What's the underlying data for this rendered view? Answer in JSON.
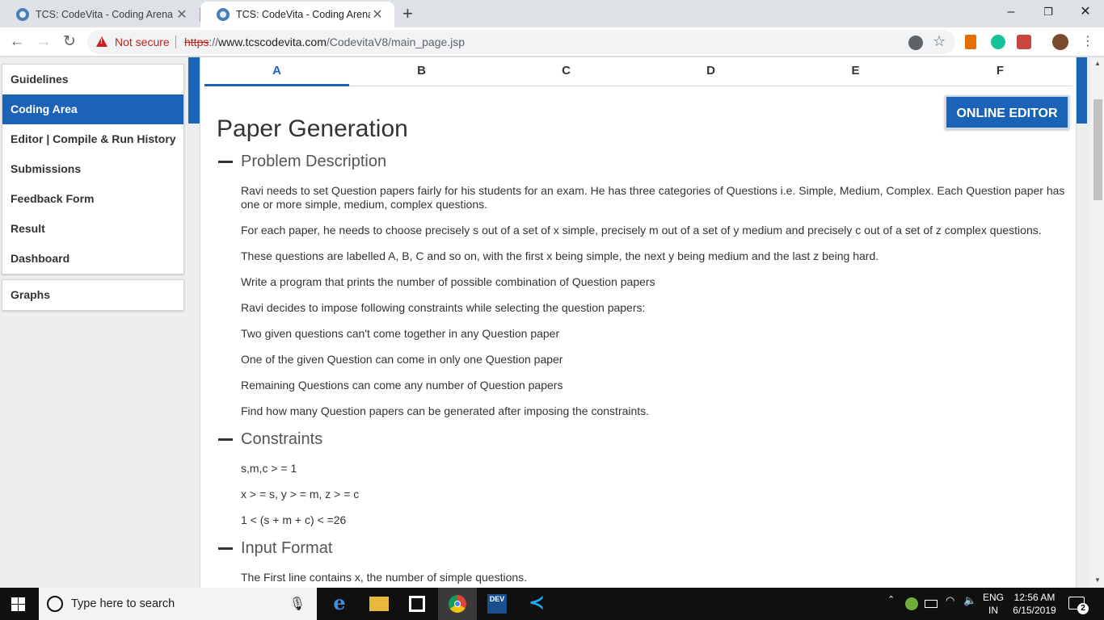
{
  "browser": {
    "tabs": [
      {
        "title": "TCS: CodeVita - Coding Arena",
        "close": "✕"
      },
      {
        "title": "TCS: CodeVita - Coding Arena",
        "close": "✕"
      }
    ],
    "new_tab": "+",
    "window_controls": {
      "minimize": "–",
      "restore": "❐",
      "close": "✕"
    },
    "security_label": "Not secure",
    "url_scheme": "https",
    "url_rest": "://",
    "url_host": "www.tcscodevita.com",
    "url_path": "/CodevitaV8/main_page.jsp",
    "nav": {
      "back": "←",
      "forward": "→",
      "reload": "↻"
    }
  },
  "sidebar": {
    "items": [
      {
        "label": "Guidelines"
      },
      {
        "label": "Coding Area",
        "active": true
      },
      {
        "label": "Editor | Compile & Run History"
      },
      {
        "label": "Submissions"
      },
      {
        "label": "Feedback Form"
      },
      {
        "label": "Result"
      },
      {
        "label": "Dashboard"
      }
    ],
    "graphs_label": "Graphs"
  },
  "problem_tabs": [
    "A",
    "B",
    "C",
    "D",
    "E",
    "F"
  ],
  "active_tab": "A",
  "editor_button": "ONLINE EDITOR (A)",
  "problem": {
    "title": "Paper Generation",
    "description_heading": "Problem Description",
    "description": [
      "Ravi needs to set Question papers fairly for his students for an exam. He has three categories of Questions i.e. Simple, Medium, Complex. Each Question paper has one or more simple, medium, complex questions.",
      "For each paper, he needs to choose precisely s out of a set of x simple, precisely m out of a set of y medium and precisely c out of a set of z complex questions.",
      "These questions are labelled A, B, C and so on, with the first x being simple, the next y being medium and the last z being hard.",
      "Write a program that prints the number of possible combination of Question papers",
      "Ravi decides to impose following constraints while selecting the question papers:",
      "Two given questions can't come together in any Question paper",
      "One of the given Question can come in only one Question paper",
      "Remaining Questions can come any number of Question papers",
      "Find how many Question papers can be generated after imposing the constraints."
    ],
    "constraints_heading": "Constraints",
    "constraints": [
      "s,m,c > = 1",
      "x > = s, y > = m, z > = c",
      "1 < (s + m + c) < =26"
    ],
    "input_heading": "Input Format",
    "input": [
      "The First line contains x, the number of simple questions."
    ]
  },
  "taskbar": {
    "search_placeholder": "Type here to search",
    "language": "ENG",
    "region": "IN",
    "time": "12:56 AM",
    "date": "6/15/2019",
    "notification_count": "2"
  },
  "colors": {
    "accent": "#1b63b7",
    "not_secure": "#c5221f"
  }
}
